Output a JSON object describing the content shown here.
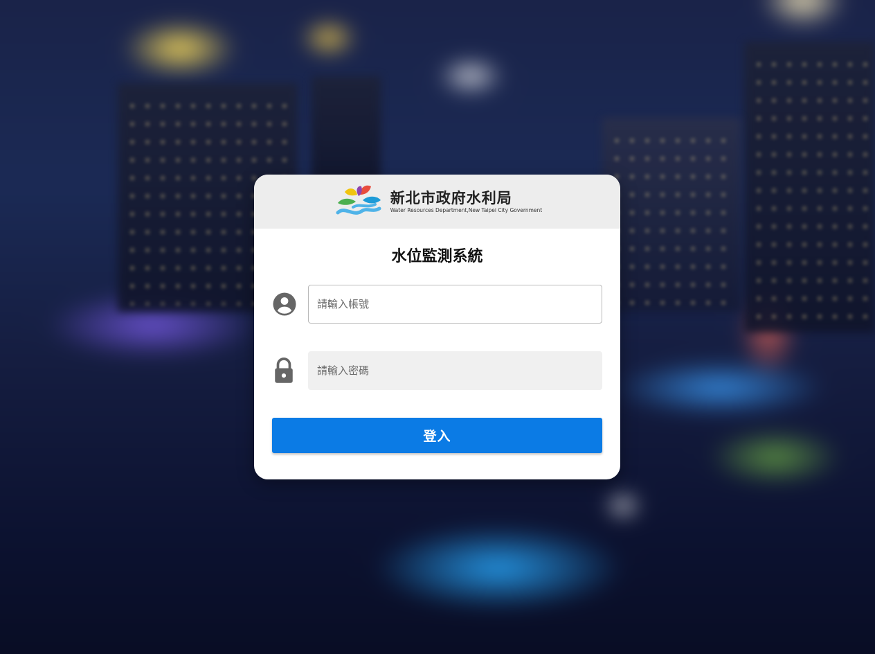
{
  "organization": {
    "name_zh": "新北市政府水利局",
    "name_en": "Water Resources Department,New Taipei City Government"
  },
  "system": {
    "title": "水位監測系統"
  },
  "form": {
    "username": {
      "placeholder": "請輸入帳號",
      "value": "",
      "icon": "account-circle-icon"
    },
    "password": {
      "placeholder": "請輸入密碼",
      "value": "",
      "icon": "lock-icon"
    },
    "submit_label": "登入"
  },
  "colors": {
    "primary_button": "#0b7be5",
    "header_bg": "#ededed",
    "icon_gray": "#666666"
  }
}
